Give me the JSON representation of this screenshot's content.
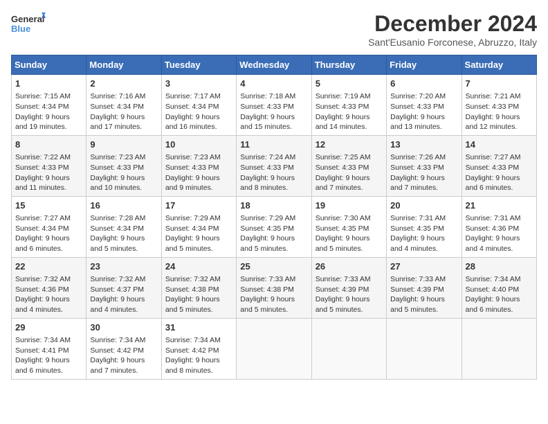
{
  "header": {
    "logo_line1": "General",
    "logo_line2": "Blue",
    "title": "December 2024",
    "subtitle": "Sant'Eusanio Forconese, Abruzzo, Italy"
  },
  "calendar": {
    "weekdays": [
      "Sunday",
      "Monday",
      "Tuesday",
      "Wednesday",
      "Thursday",
      "Friday",
      "Saturday"
    ],
    "weeks": [
      [
        {
          "day": "1",
          "info": "Sunrise: 7:15 AM\nSunset: 4:34 PM\nDaylight: 9 hours and 19 minutes."
        },
        {
          "day": "2",
          "info": "Sunrise: 7:16 AM\nSunset: 4:34 PM\nDaylight: 9 hours and 17 minutes."
        },
        {
          "day": "3",
          "info": "Sunrise: 7:17 AM\nSunset: 4:34 PM\nDaylight: 9 hours and 16 minutes."
        },
        {
          "day": "4",
          "info": "Sunrise: 7:18 AM\nSunset: 4:33 PM\nDaylight: 9 hours and 15 minutes."
        },
        {
          "day": "5",
          "info": "Sunrise: 7:19 AM\nSunset: 4:33 PM\nDaylight: 9 hours and 14 minutes."
        },
        {
          "day": "6",
          "info": "Sunrise: 7:20 AM\nSunset: 4:33 PM\nDaylight: 9 hours and 13 minutes."
        },
        {
          "day": "7",
          "info": "Sunrise: 7:21 AM\nSunset: 4:33 PM\nDaylight: 9 hours and 12 minutes."
        }
      ],
      [
        {
          "day": "8",
          "info": "Sunrise: 7:22 AM\nSunset: 4:33 PM\nDaylight: 9 hours and 11 minutes."
        },
        {
          "day": "9",
          "info": "Sunrise: 7:23 AM\nSunset: 4:33 PM\nDaylight: 9 hours and 10 minutes."
        },
        {
          "day": "10",
          "info": "Sunrise: 7:23 AM\nSunset: 4:33 PM\nDaylight: 9 hours and 9 minutes."
        },
        {
          "day": "11",
          "info": "Sunrise: 7:24 AM\nSunset: 4:33 PM\nDaylight: 9 hours and 8 minutes."
        },
        {
          "day": "12",
          "info": "Sunrise: 7:25 AM\nSunset: 4:33 PM\nDaylight: 9 hours and 7 minutes."
        },
        {
          "day": "13",
          "info": "Sunrise: 7:26 AM\nSunset: 4:33 PM\nDaylight: 9 hours and 7 minutes."
        },
        {
          "day": "14",
          "info": "Sunrise: 7:27 AM\nSunset: 4:33 PM\nDaylight: 9 hours and 6 minutes."
        }
      ],
      [
        {
          "day": "15",
          "info": "Sunrise: 7:27 AM\nSunset: 4:34 PM\nDaylight: 9 hours and 6 minutes."
        },
        {
          "day": "16",
          "info": "Sunrise: 7:28 AM\nSunset: 4:34 PM\nDaylight: 9 hours and 5 minutes."
        },
        {
          "day": "17",
          "info": "Sunrise: 7:29 AM\nSunset: 4:34 PM\nDaylight: 9 hours and 5 minutes."
        },
        {
          "day": "18",
          "info": "Sunrise: 7:29 AM\nSunset: 4:35 PM\nDaylight: 9 hours and 5 minutes."
        },
        {
          "day": "19",
          "info": "Sunrise: 7:30 AM\nSunset: 4:35 PM\nDaylight: 9 hours and 5 minutes."
        },
        {
          "day": "20",
          "info": "Sunrise: 7:31 AM\nSunset: 4:35 PM\nDaylight: 9 hours and 4 minutes."
        },
        {
          "day": "21",
          "info": "Sunrise: 7:31 AM\nSunset: 4:36 PM\nDaylight: 9 hours and 4 minutes."
        }
      ],
      [
        {
          "day": "22",
          "info": "Sunrise: 7:32 AM\nSunset: 4:36 PM\nDaylight: 9 hours and 4 minutes."
        },
        {
          "day": "23",
          "info": "Sunrise: 7:32 AM\nSunset: 4:37 PM\nDaylight: 9 hours and 4 minutes."
        },
        {
          "day": "24",
          "info": "Sunrise: 7:32 AM\nSunset: 4:38 PM\nDaylight: 9 hours and 5 minutes."
        },
        {
          "day": "25",
          "info": "Sunrise: 7:33 AM\nSunset: 4:38 PM\nDaylight: 9 hours and 5 minutes."
        },
        {
          "day": "26",
          "info": "Sunrise: 7:33 AM\nSunset: 4:39 PM\nDaylight: 9 hours and 5 minutes."
        },
        {
          "day": "27",
          "info": "Sunrise: 7:33 AM\nSunset: 4:39 PM\nDaylight: 9 hours and 5 minutes."
        },
        {
          "day": "28",
          "info": "Sunrise: 7:34 AM\nSunset: 4:40 PM\nDaylight: 9 hours and 6 minutes."
        }
      ],
      [
        {
          "day": "29",
          "info": "Sunrise: 7:34 AM\nSunset: 4:41 PM\nDaylight: 9 hours and 6 minutes."
        },
        {
          "day": "30",
          "info": "Sunrise: 7:34 AM\nSunset: 4:42 PM\nDaylight: 9 hours and 7 minutes."
        },
        {
          "day": "31",
          "info": "Sunrise: 7:34 AM\nSunset: 4:42 PM\nDaylight: 9 hours and 8 minutes."
        },
        null,
        null,
        null,
        null
      ]
    ]
  }
}
